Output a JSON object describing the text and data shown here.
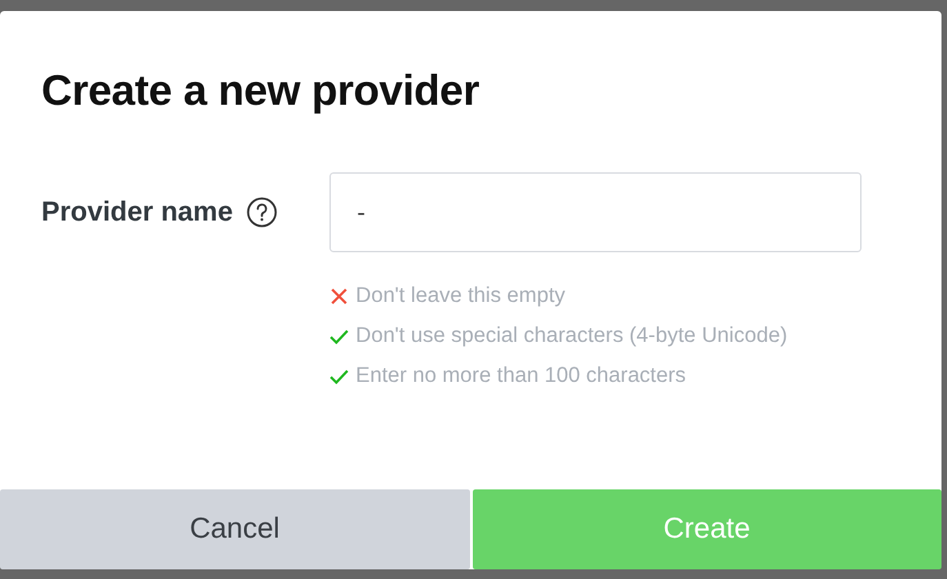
{
  "dialog": {
    "title": "Create a new provider",
    "field": {
      "label": "Provider name",
      "value": "-"
    },
    "rules": [
      {
        "text": "Don't leave this empty",
        "passed": false
      },
      {
        "text": "Don't use special characters (4-byte Unicode)",
        "passed": true
      },
      {
        "text": "Enter no more than 100 characters",
        "passed": true
      }
    ],
    "buttons": [
      {
        "label": "Cancel",
        "kind": "secondary"
      },
      {
        "label": "Create",
        "kind": "primary"
      }
    ]
  }
}
